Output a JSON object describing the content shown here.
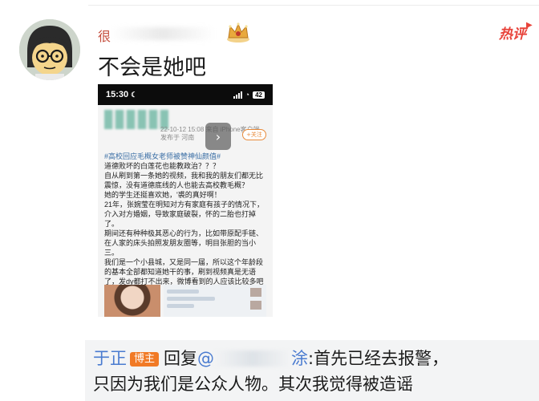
{
  "comment": {
    "username": "很",
    "text": "不会是她吧",
    "hot_label": "热评",
    "hot_arrow": "▶"
  },
  "phone": {
    "status_time": "15:30",
    "status_moon": "☾",
    "battery": "42",
    "post_meta_line1": "22-10-12 15:08  来自 iPhone客户端",
    "post_meta_line2": "发布于 河南",
    "follow_label": "+关注",
    "nav_chevron": "›",
    "body_lines": [
      "#高校回应毛概女老师被赞神仙颜值#",
      "道德败坏的白莲花也能教政治？？？",
      "自从刷到第一条她的视频，我和我的朋友们都无比",
      "震惊，没有道德底线的人也能去高校教毛概？",
      "她的学生还挺喜欢她，'裘的真好啊！",
      "21年，张婉莹在明知对方有家庭有孩子的情况下，",
      "介入对方婚姻，导致家庭破裂，怀的二胎也打掉",
      "了。",
      "期间还有种种极其恶心的行为，比如带原配手链、",
      "在人家的床头拍照发朋友圈等，明目张胆的当小",
      "三。",
      "我们是一个小县城，又是同一届，所以这个年龄段",
      "的基本全部都知道她干的事，刷到视频真是无语",
      "了，发dy都打不出来，微博看到的人应该比较多吧"
    ]
  },
  "reply": {
    "author": "于正",
    "badge": "博主",
    "reply_word": "回复",
    "mention_prefix": "@",
    "mention_suffix": "涂",
    "line1_text": ":首先已经去报警，",
    "line2_text": "只因为我们是公众人物。其次我觉得被造谣"
  }
}
